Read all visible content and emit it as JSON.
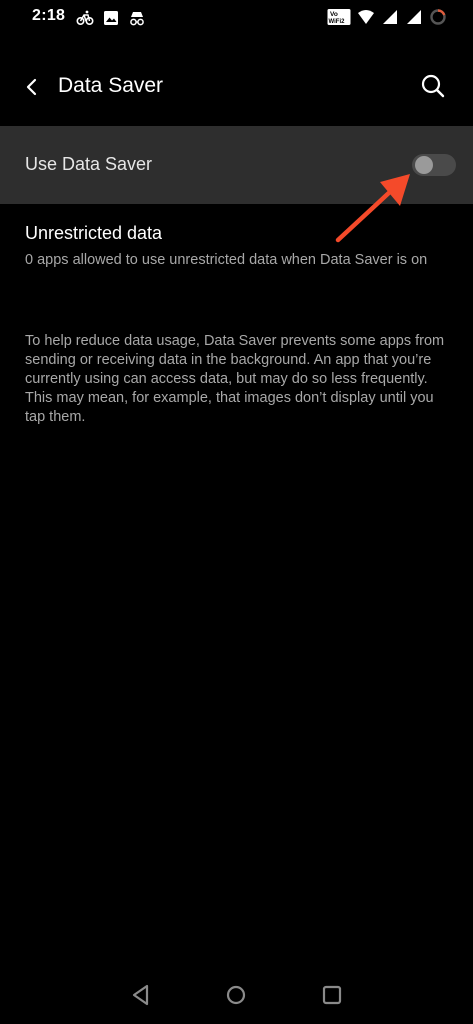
{
  "status_bar": {
    "time": "2:18",
    "left_icons": [
      "cycling-notification-icon",
      "gallery-notification-icon",
      "incognito-notification-icon"
    ],
    "right_icons": [
      "volte-wifi2-icon",
      "wifi-icon",
      "cell-signal-icon",
      "cell-signal-2-icon",
      "battery-ring-icon"
    ],
    "volte_label_top": "Vo",
    "volte_label_bottom": "WiFi2"
  },
  "app_bar": {
    "title": "Data Saver",
    "back_icon": "back-arrow-icon",
    "search_icon": "search-icon"
  },
  "data_saver": {
    "label": "Use Data Saver",
    "enabled": false
  },
  "unrestricted": {
    "title": "Unrestricted data",
    "summary": "0 apps allowed to use unrestricted data when Data Saver is on"
  },
  "footer": {
    "description": "To help reduce data usage, Data Saver prevents some apps from sending or receiving data in the background. An app that you’re currently using can access data, but may do so less frequently. This may mean, for example, that images don’t display until you tap them."
  },
  "annotation": {
    "arrow_color": "#f44a2a"
  },
  "nav_bar": {
    "buttons": [
      "nav-back-icon",
      "nav-home-icon",
      "nav-recents-icon"
    ]
  },
  "colors": {
    "background": "#000000",
    "row_highlight": "#2e2e2e",
    "secondary_text": "#a8a8a8"
  }
}
